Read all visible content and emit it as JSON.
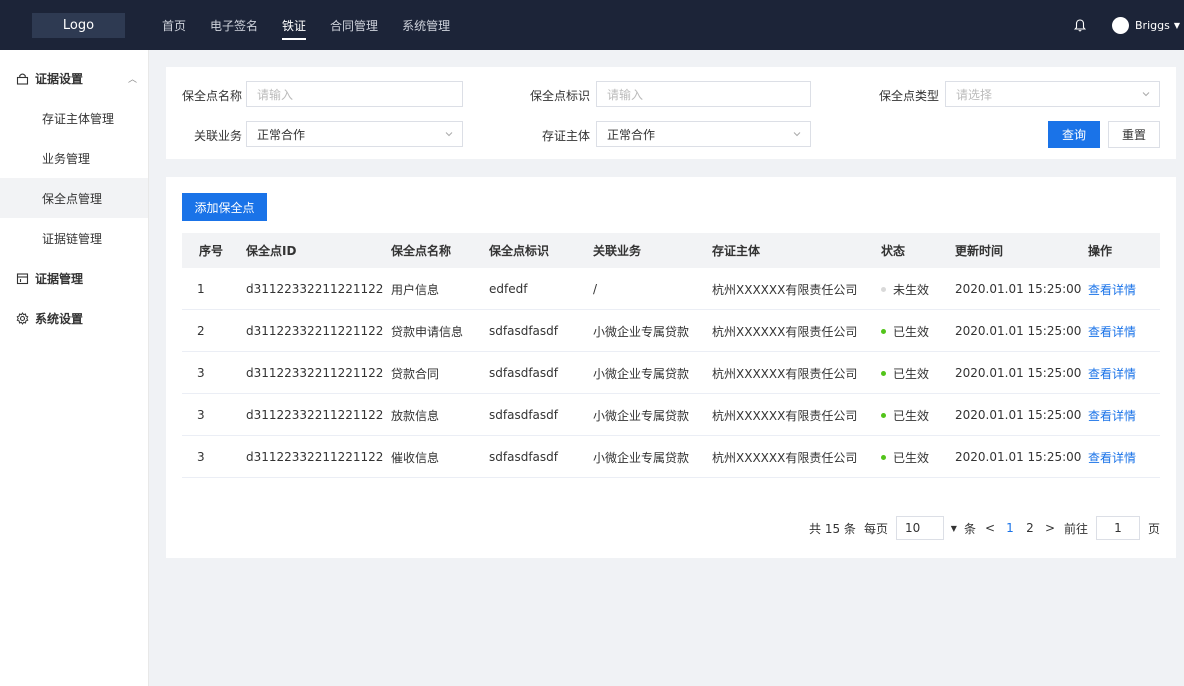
{
  "header": {
    "logo": "Logo",
    "nav": [
      "首页",
      "电子签名",
      "铁证",
      "合同管理",
      "系统管理"
    ],
    "active_nav": 2,
    "user": "Briggs",
    "icons": {
      "bell": "bell-icon",
      "caret": "caret-down-icon"
    }
  },
  "sidebar": {
    "groups": [
      {
        "label": "证据设置",
        "icon": "lock-icon",
        "expanded": true
      },
      {
        "label": "证据管理",
        "icon": "calendar-icon"
      },
      {
        "label": "系统设置",
        "icon": "gear-icon"
      }
    ],
    "items": [
      "存证主体管理",
      "业务管理",
      "保全点管理",
      "证据链管理"
    ],
    "active_item": 2
  },
  "filter": {
    "name_label": "保全点名称",
    "name_placeholder": "请输入",
    "id_label": "保全点标识",
    "id_placeholder": "请输入",
    "type_label": "保全点类型",
    "type_placeholder": "请选择",
    "biz_label": "关联业务",
    "biz_value": "正常合作",
    "subject_label": "存证主体",
    "subject_value": "正常合作",
    "query_button": "查询",
    "reset_button": "重置"
  },
  "table": {
    "add_button": "添加保全点",
    "columns": [
      "序号",
      "保全点ID",
      "保全点名称",
      "保全点标识",
      "关联业务",
      "存证主体",
      "状态",
      "更新时间",
      "操作"
    ],
    "rows": [
      {
        "no": "1",
        "id": "d31122332211221122",
        "name": "用户信息",
        "tag": "edfedf",
        "biz": "/",
        "subject": "杭州XXXXXX有限责任公司",
        "status": "未生效",
        "status_color": "#d9d9d9",
        "time": "2020.01.01 15:25:00",
        "action": "查看详情"
      },
      {
        "no": "2",
        "id": "d31122332211221122",
        "name": "贷款申请信息",
        "tag": "sdfasdfasdf",
        "biz": "小微企业专属贷款",
        "subject": "杭州XXXXXX有限责任公司",
        "status": "已生效",
        "status_color": "#52c41a",
        "time": "2020.01.01 15:25:00",
        "action": "查看详情"
      },
      {
        "no": "3",
        "id": "d31122332211221122",
        "name": "贷款合同",
        "tag": "sdfasdfasdf",
        "biz": "小微企业专属贷款",
        "subject": "杭州XXXXXX有限责任公司",
        "status": "已生效",
        "status_color": "#52c41a",
        "time": "2020.01.01 15:25:00",
        "action": "查看详情"
      },
      {
        "no": "3",
        "id": "d31122332211221122",
        "name": "放款信息",
        "tag": "sdfasdfasdf",
        "biz": "小微企业专属贷款",
        "subject": "杭州XXXXXX有限责任公司",
        "status": "已生效",
        "status_color": "#52c41a",
        "time": "2020.01.01 15:25:00",
        "action": "查看详情"
      },
      {
        "no": "3",
        "id": "d31122332211221122",
        "name": "催收信息",
        "tag": "sdfasdfasdf",
        "biz": "小微企业专属贷款",
        "subject": "杭州XXXXXX有限责任公司",
        "status": "已生效",
        "status_color": "#52c41a",
        "time": "2020.01.01 15:25:00",
        "action": "查看详情"
      }
    ]
  },
  "pagination": {
    "total": "共 15 条",
    "per_page_label": "每页",
    "per_page": "10",
    "unit": "条",
    "pages": [
      "1",
      "2"
    ],
    "current": "1",
    "goto_label": "前往",
    "goto_value": "1",
    "page_unit": "页",
    "accent": "#1a73e8"
  }
}
